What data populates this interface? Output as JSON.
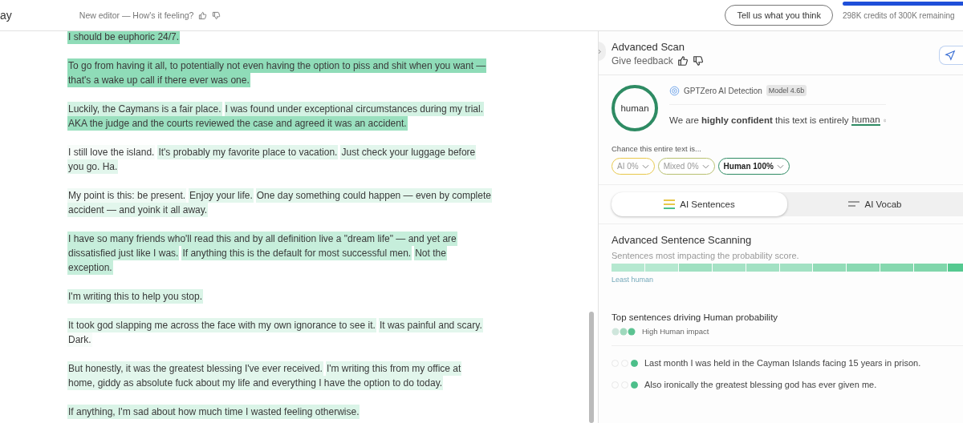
{
  "header": {
    "doc_title": "ay",
    "editor_prompt": "New editor — How's it feeling?",
    "feedback_button": "Tell us what you think",
    "credits": {
      "level": 0.99,
      "text": "298K credits of 300K remaining"
    }
  },
  "document": {
    "paragraphs": [
      {
        "lines": [
          {
            "segments": [
              {
                "text": "I should be euphoric 24/7.",
                "color": "#8fdcb8"
              }
            ]
          }
        ]
      },
      {
        "lines": [
          {
            "segments": [
              {
                "text": "To go from having it all, to potentially not even having the option to piss and shit when you want —",
                "color": "#8fdcb8"
              }
            ]
          },
          {
            "segments": [
              {
                "text": "that's a wake up call if there ever was one.",
                "color": "#8fdcb8"
              }
            ]
          }
        ]
      },
      {
        "lines": [
          {
            "segments": [
              {
                "text": "Luckily, the Caymans is a fair place.",
                "color": "#d3f2e3"
              },
              {
                "text": "I was found under exceptional circumstances during my trial.",
                "color": "#d3f2e3"
              }
            ]
          },
          {
            "segments": [
              {
                "text": "AKA the judge and the courts reviewed the case and agreed it was an accident.",
                "color": "#9ae0bf"
              }
            ]
          }
        ]
      },
      {
        "lines": [
          {
            "segments": [
              {
                "text": "I still love the island.",
                "color": "#f7fcf9"
              },
              {
                "text": "It's probably my favorite place to vacation.",
                "color": "#e2f6ec"
              },
              {
                "text": "Just check your luggage before",
                "color": "#e2f6ec"
              }
            ]
          },
          {
            "segments": [
              {
                "text": "you go. Ha.",
                "color": "#e2f6ec"
              }
            ]
          }
        ]
      },
      {
        "lines": [
          {
            "segments": [
              {
                "text": "My point is this: be present.",
                "color": "#f0faf5"
              },
              {
                "text": "Enjoy your life.",
                "color": "#e2f6ec"
              },
              {
                "text": "One day something could happen — even by complete",
                "color": "#e2f6ec"
              }
            ]
          },
          {
            "segments": [
              {
                "text": "accident — and yoink it all away.",
                "color": "#e2f6ec"
              }
            ]
          }
        ]
      },
      {
        "lines": [
          {
            "segments": [
              {
                "text": "I have so many friends who'll read this and by all definition live a \"dream life\" — and yet are",
                "color": "#c6eedb"
              }
            ]
          },
          {
            "segments": [
              {
                "text": "dissatisfied just like I was.",
                "color": "#c6eedb"
              },
              {
                "text": "If anything this is the default for most successful men.",
                "color": "#c6eedb"
              },
              {
                "text": "Not the",
                "color": "#c6eedb"
              }
            ]
          },
          {
            "segments": [
              {
                "text": "exception.",
                "color": "#c6eedb"
              }
            ]
          }
        ]
      },
      {
        "lines": [
          {
            "segments": [
              {
                "text": "I'm writing this to help you stop.",
                "color": "#daf4e7"
              }
            ]
          }
        ]
      },
      {
        "lines": [
          {
            "segments": [
              {
                "text": "It took god slapping me across the face with my own ignorance to see it.",
                "color": "#e2f6ec"
              },
              {
                "text": "It was painful and scary.",
                "color": "#e2f6ec"
              }
            ]
          },
          {
            "segments": [
              {
                "text": "Dark.",
                "color": "#f7fcf9"
              }
            ]
          }
        ]
      },
      {
        "lines": [
          {
            "segments": [
              {
                "text": "But honestly, it was the greatest blessing I've ever received.",
                "color": "#e2f6ec"
              },
              {
                "text": "I'm writing this from my office at",
                "color": "#e2f6ec"
              }
            ]
          },
          {
            "segments": [
              {
                "text": "home, giddy as absolute fuck about my life and everything I have the option to do today.",
                "color": "#e2f6ec"
              }
            ]
          }
        ]
      },
      {
        "lines": [
          {
            "segments": [
              {
                "text": "If anything, I'm sad about how much time I wasted feeling otherwise.",
                "color": "#daf4e7"
              }
            ]
          }
        ]
      }
    ]
  },
  "panel": {
    "title": "Advanced Scan",
    "give_feedback": "Give feedback",
    "result": {
      "ring_label": "human",
      "detector": "GPTZero AI Detection",
      "model_badge": "Model 4.6b",
      "verdict_text": "We are **highly confident** this text is entirely",
      "verdict_word": "human"
    },
    "chance_label": "Chance this entire text is...",
    "chips": [
      {
        "label": "AI 0%",
        "color": "#e8c84a",
        "selected": false
      },
      {
        "label": "Mixed 0%",
        "color": "#b8c070",
        "selected": false
      },
      {
        "label": "Human 100%",
        "color": "#2e8b63",
        "selected": true
      }
    ],
    "tabs": [
      {
        "label": "AI Sentences",
        "selected": true
      },
      {
        "label": "AI Vocab",
        "selected": false
      }
    ],
    "scanning": {
      "title": "Advanced Sentence Scanning",
      "subtitle": "Sentences most impacting the probability score.",
      "segments": [
        {
          "color": "#b5e8d0"
        },
        {
          "color": "#b5e8d0"
        },
        {
          "color": "#9fe0c1"
        },
        {
          "color": "#a5e2c5"
        },
        {
          "color": "#a2e1c3"
        },
        {
          "color": "#a2e1c3"
        },
        {
          "color": "#93dcb8"
        },
        {
          "color": "#8ad9b2"
        },
        {
          "color": "#86d8af"
        },
        {
          "color": "#80d6ab"
        },
        {
          "color": "#55c990"
        }
      ],
      "scale_label": "Least human"
    },
    "top": {
      "title": "Top sentences driving Human probability",
      "legend": "High Human impact",
      "items": [
        {
          "dots": [
            {
              "filled": false
            },
            {
              "filled": false
            },
            {
              "filled": true
            }
          ],
          "text": "Last month I was held in the Cayman Islands facing 15 years in prison."
        },
        {
          "dots": [
            {
              "filled": false
            },
            {
              "filled": false
            },
            {
              "filled": true
            }
          ],
          "text": "Also ironically the greatest blessing god has ever given me."
        }
      ]
    }
  }
}
